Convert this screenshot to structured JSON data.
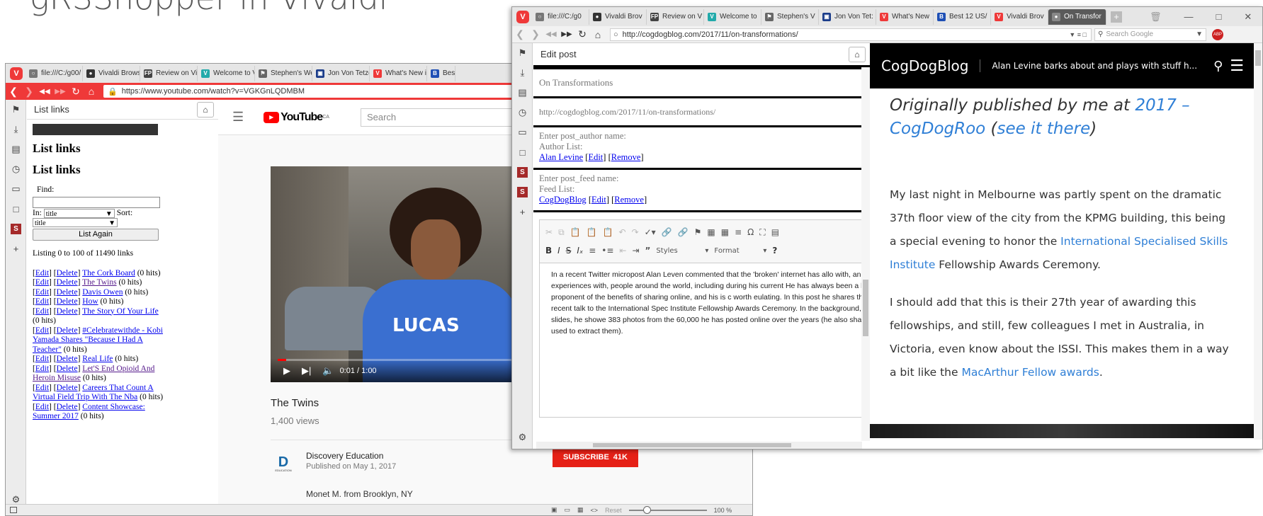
{
  "slide_title": "gRSShopper in Vivaldi",
  "win1": {
    "tabs": [
      {
        "label": "file:///C:/g00/",
        "color": "#777",
        "glyph": "○"
      },
      {
        "label": "Vivaldi Brows",
        "color": "#333",
        "glyph": "●"
      },
      {
        "label": "Review on Vi",
        "color": "#444",
        "glyph": "FP"
      },
      {
        "label": "Welcome to V",
        "color": "#2aa",
        "glyph": "V"
      },
      {
        "label": "Stephen's We",
        "color": "#666",
        "glyph": "⚑"
      },
      {
        "label": "Jon Von Tetzc",
        "color": "#1a3c8a",
        "glyph": "▣"
      },
      {
        "label": "What's New i",
        "color": "#ef3939",
        "glyph": "V"
      },
      {
        "label": "Best",
        "color": "#1e4fb5",
        "glyph": "B"
      }
    ],
    "url": "https://www.youtube.com/watch?v=VGKGnLQDMBM",
    "panel": {
      "title": "List links",
      "heading1": "List links",
      "heading2": "List links",
      "find_label": "Find:",
      "in_label": "In:",
      "in_value": "title",
      "sort_label": "Sort:",
      "sort_value": "title",
      "list_again": "List Again",
      "listing": "Listing 0 to 100 of 11490 links",
      "links": [
        {
          "title": "The Cork Board",
          "hits": "(0 hits)",
          "visited": false
        },
        {
          "title": "The Twins",
          "hits": "(0 hits)",
          "visited": true
        },
        {
          "title": "Davis Owen",
          "hits": "(0 hits)",
          "visited": false
        },
        {
          "title": "How",
          "hits": "(0 hits)",
          "visited": false
        },
        {
          "title": "The Story Of Your Life",
          "hits": "(0 hits)",
          "visited": false
        },
        {
          "title": "#Celebratewithde - Kobi Yamada Shares \"Because I Had A Teacher\"",
          "hits": "(0 hits)",
          "visited": false
        },
        {
          "title": "Real Life",
          "hits": "(0 hits)",
          "visited": false
        },
        {
          "title": "Let'S End Opioid And Heroin Misuse",
          "hits": "(0 hits)",
          "visited": true
        },
        {
          "title": "Careers That Count A Virtual Field Trip With The Nba",
          "hits": "(0 hits)",
          "visited": false
        },
        {
          "title": "Content Showcase: Summer 2017",
          "hits": "(0 hits)",
          "visited": false
        }
      ],
      "edit": "Edit",
      "delete": "Delete"
    },
    "youtube": {
      "logo": "YouTube",
      "region": "CA",
      "search_placeholder": "Search",
      "overlay_name": "LUCAS",
      "time": "0:01 / 1:00",
      "video_title": "The Twins",
      "views": "1,400 views",
      "channel": "Discovery Education",
      "published": "Published on May 1, 2017",
      "subscribe": "SUBSCRIBE",
      "subscribers": "41K",
      "description": "Monet M. from Brooklyn, NY",
      "channel_logo_text": "EDUCATION"
    },
    "status": {
      "reset": "Reset",
      "zoom": "100 %"
    }
  },
  "win2": {
    "tabs": [
      {
        "label": "file:///C:/g0",
        "color": "#777",
        "glyph": "○",
        "active": false
      },
      {
        "label": "Vivaldi Brov",
        "color": "#333",
        "glyph": "●",
        "active": false
      },
      {
        "label": "Review on V",
        "color": "#444",
        "glyph": "FP",
        "active": false
      },
      {
        "label": "Welcome to",
        "color": "#2aa",
        "glyph": "V",
        "active": false
      },
      {
        "label": "Stephen's V",
        "color": "#666",
        "glyph": "⚑",
        "active": false
      },
      {
        "label": "Jon Von Tet:",
        "color": "#1a3c8a",
        "glyph": "▣",
        "active": false
      },
      {
        "label": "What's New",
        "color": "#ef3939",
        "glyph": "V",
        "active": false
      },
      {
        "label": "Best 12 US/",
        "color": "#1e4fb5",
        "glyph": "B",
        "active": false
      },
      {
        "label": "Vivaldi Brov",
        "color": "#ef3939",
        "glyph": "V",
        "active": false
      },
      {
        "label": "On Transfor",
        "color": "#888",
        "glyph": "●",
        "active": true
      }
    ],
    "url": "http://cogdogblog.com/2017/11/on-transformations/",
    "search_placeholder": "Search Google",
    "editpost": {
      "title": "Edit post",
      "post_title": "On Transformations",
      "post_url": "http://cogdogblog.com/2017/11/on-transformations/",
      "author_prompt": "Enter post_author name:",
      "author_list": "Author List:",
      "author": "Alan Levine",
      "feed_prompt": "Enter post_feed name:",
      "feed_list": "Feed List:",
      "feed": "CogDogBlog",
      "edit": "Edit",
      "remove": "Remove",
      "styles": "Styles",
      "format": "Format",
      "body": "In a recent Twitter micropost Alan Leven commented that the 'broken' internet has allo with, and have experiences with, people around the world, including during his current He has always been a leading proponent of the benefits of sharing online, and his is c worth eulating. In this post he shares the text of a recent talk to  the International Spec Institute Fellowship Awards Ceremony. In the background, instead of slides, he showe 383 photos from the 60,000 he has posted online over the years (he also shares the t used to extract them)."
    },
    "blog": {
      "name": "CogDogBlog",
      "tagline": "Alan Levine barks about and plays with stuff h...",
      "intro_prefix": "Originally published by me at ",
      "intro_link": "2017 – CogDogRoo",
      "intro_mid": " (",
      "intro_link2": "see it there",
      "intro_suffix": ")",
      "p1_a": "My last night in Melbourne was partly spent on the dramatic 37th floor view of the city from the KPMG building, this being a special evening to honor the ",
      "p1_link": "International Specialised Skills Institute",
      "p1_b": " Fellowship Awards Ceremony.",
      "p2_a": "I should add that this is their 27th year of awarding this fellowships, and still, few colleagues I met in Australia, in Victoria, even know about the ISSI. This makes them in a way a bit like the ",
      "p2_link": "MacArthur Fellow awards",
      "p2_b": "."
    }
  },
  "colors": {
    "vivaldi_red": "#ef3939",
    "youtube_red": "#ff0000",
    "link_blue": "#2f7fd6",
    "visited": "#551a8b"
  }
}
